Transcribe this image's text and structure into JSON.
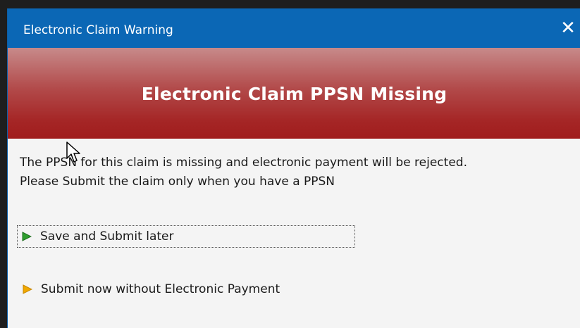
{
  "window": {
    "title": "Electronic Claim Warning",
    "close_icon": "close-icon"
  },
  "banner": {
    "title": "Electronic Claim PPSN Missing"
  },
  "message": {
    "line1": "The PPSN for this claim is missing and electronic payment will be rejected.",
    "line2": "Please Submit the claim only when you have a PPSN"
  },
  "options": [
    {
      "label": "Save and Submit later",
      "icon": "green-arrow-icon",
      "color": "#2e9e2e"
    },
    {
      "label": "Submit now without Electronic Payment",
      "icon": "orange-arrow-icon",
      "color": "#f0a800"
    }
  ],
  "colors": {
    "titlebar": "#0b67b5",
    "banner": "#a52626"
  }
}
